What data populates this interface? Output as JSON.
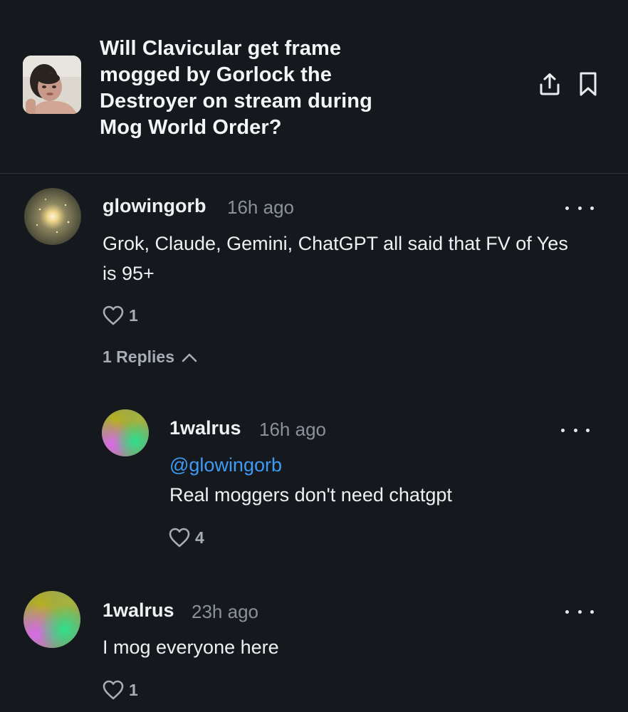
{
  "market": {
    "title": "Will Clavicular get frame mogged by Gorlock the Destroyer on stream during Mog World Order?",
    "thumbnail_icon": "market-thumbnail-photo",
    "share_icon": "share-icon",
    "bookmark_icon": "bookmark-icon"
  },
  "comments": [
    {
      "username": "glowingorb",
      "time": "16h ago",
      "text": "Grok, Claude, Gemini, ChatGPT all said that FV of Yes is 95+",
      "likes": "1",
      "replies_label": "1 Replies"
    },
    {
      "username": "1walrus",
      "time": "16h ago",
      "mention": "@glowingorb",
      "text": "Real moggers don't need chatgpt",
      "likes": "4"
    },
    {
      "username": "1walrus",
      "time": "23h ago",
      "text": "I mog everyone here",
      "likes": "1"
    }
  ],
  "colors": {
    "background": "#15181d",
    "mention": "#3d9bf5",
    "muted": "#8a919b",
    "divider": "#2b3038"
  }
}
